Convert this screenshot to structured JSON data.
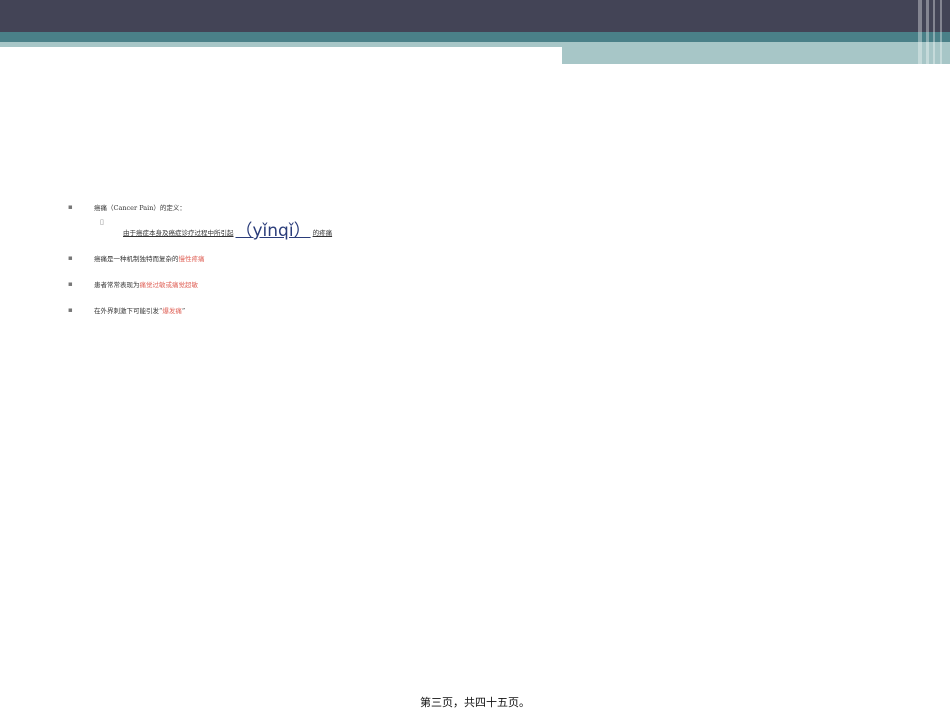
{
  "colors": {
    "header_dark": "#434456",
    "header_teal": "#4a8088",
    "header_light": "#a7c6c7",
    "highlight_red": "#e0645a"
  },
  "bullet_symbol": "▪",
  "sub_bullet_symbol": "▯",
  "items": [
    {
      "pre": "癌痛（Cancer Pain）的定义：",
      "hl": "",
      "post": ""
    },
    {
      "pre": "癌痛是一种机制独特而复杂的",
      "hl": "慢性疼痛",
      "post": ""
    },
    {
      "pre": "患者常常表现为",
      "hl": "痛觉过敏或痛觉超敏",
      "post": ""
    },
    {
      "pre": "在外界刺激下可能引发“",
      "hl": "爆发痛",
      "post": "”"
    }
  ],
  "sub_item": {
    "pre": "由于癌症本身及癌症诊疗过程中所引起",
    "pinyin": "（yǐnqǐ）",
    "post": "的疼痛"
  },
  "footer": "第三页，共四十五页。"
}
